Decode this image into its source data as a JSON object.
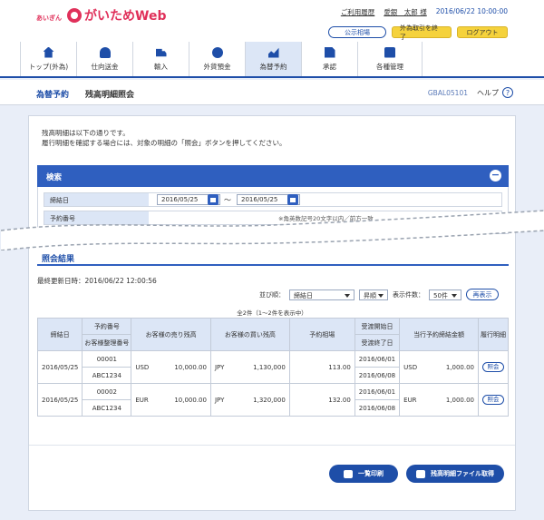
{
  "header": {
    "brand_small": "あいぎん",
    "brand_name": "がいためWeb",
    "usage_history": "ご利用履歴",
    "user_name": "愛銀　太郎 様",
    "datetime": "2016/06/22 10:00:00",
    "btn_rates": "公示相場",
    "btn_end_fx": "外為取引を終了",
    "btn_logout": "ログアウト"
  },
  "nav": [
    {
      "label": "トップ(外為)",
      "icon": "home-icon"
    },
    {
      "label": "仕向送金",
      "icon": "person-icon"
    },
    {
      "label": "輸入",
      "icon": "truck-icon"
    },
    {
      "label": "外貨預金",
      "icon": "coin-icon"
    },
    {
      "label": "為替予約",
      "icon": "rate-icon"
    },
    {
      "label": "承認",
      "icon": "doc-icon"
    },
    {
      "label": "各種管理",
      "icon": "gear-icon"
    }
  ],
  "page": {
    "section": "為替予約",
    "title": "残高明細照会",
    "code": "GBAL05101",
    "help": "ヘルプ"
  },
  "intro": {
    "line1": "残高明細は以下の通りです。",
    "line2": "履行明細を確認する場合には、対象の明細の「照会」ボタンを押してください。"
  },
  "search": {
    "title": "検索",
    "close_date_label": "締結日",
    "date_from": "2016/05/25",
    "tilde": "～",
    "date_to": "2016/05/25",
    "contract_no_label": "予約番号",
    "hint": "※角英数記号20文字以内／前方一致"
  },
  "results": {
    "title": "照会結果",
    "updated": "最終更新日時：2016/06/22 12:00:56",
    "sort_label": "並び順：",
    "sort_value": "締結日",
    "order_value": "昇順",
    "per_page_label": "表示件数：",
    "per_page_value": "50件",
    "redisplay": "再表示",
    "count": "全2件（1～2件を表示中）"
  },
  "table": {
    "headers": {
      "close_date": "締結日",
      "contract_no": "予約番号",
      "customer_ref": "お客様整理番号",
      "sell_balance": "お客様の売り残高",
      "buy_balance": "お客様の買い残高",
      "rate": "予約相場",
      "delivery_start": "受渡開始日",
      "delivery_end": "受渡終了日",
      "today_amount": "当行予約締結金額",
      "detail": "履行明細"
    },
    "rows": [
      {
        "close_date": "2016/05/25",
        "contract_no": "00001",
        "customer_ref": "ABC1234",
        "sell_ccy": "USD",
        "sell_amount": "10,000.00",
        "buy_ccy": "JPY",
        "buy_amount": "1,130,000",
        "rate": "113.00",
        "delivery_start": "2016/06/01",
        "delivery_end": "2016/06/08",
        "today_ccy": "USD",
        "today_amount": "1,000.00",
        "inquiry": "照会"
      },
      {
        "close_date": "2016/05/25",
        "contract_no": "00002",
        "customer_ref": "ABC1234",
        "sell_ccy": "EUR",
        "sell_amount": "10,000.00",
        "buy_ccy": "JPY",
        "buy_amount": "1,320,000",
        "rate": "132.00",
        "delivery_start": "2016/06/01",
        "delivery_end": "2016/06/08",
        "today_ccy": "EUR",
        "today_amount": "1,000.00",
        "inquiry": "照会"
      }
    ]
  },
  "actions": {
    "print": "一覧印刷",
    "download": "残高明細ファイル取得"
  },
  "colors": {
    "primary": "#1e4ea8",
    "brand": "#e0305a",
    "accent_yellow": "#f5d23c"
  }
}
